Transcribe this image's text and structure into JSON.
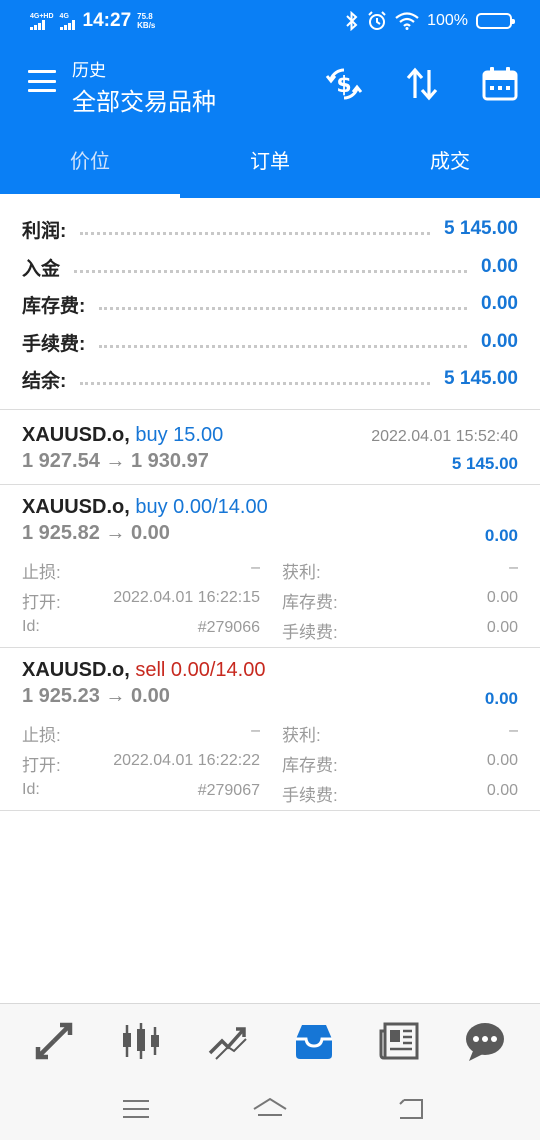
{
  "status_bar": {
    "network1": "4G+HD",
    "network2": "4G",
    "time": "14:27",
    "speed_value": "75.8",
    "speed_unit": "KB/s",
    "battery": "100%"
  },
  "header": {
    "subtitle": "历史",
    "title": "全部交易品种",
    "icons": [
      "menu-icon",
      "dollar-sync-icon",
      "sort-icon",
      "calendar-icon"
    ]
  },
  "tabs": [
    {
      "label": "价位",
      "active": true
    },
    {
      "label": "订单",
      "active": false
    },
    {
      "label": "成交",
      "active": false
    }
  ],
  "summary": [
    {
      "label": "利润:",
      "value": "5 145.00"
    },
    {
      "label": "入金",
      "value": "0.00"
    },
    {
      "label": "库存费:",
      "value": "0.00"
    },
    {
      "label": "手续费:",
      "value": "0.00"
    },
    {
      "label": "结余:",
      "value": "5 145.00"
    }
  ],
  "trades": [
    {
      "symbol": "XAUUSD.o,",
      "side": "buy 15.00",
      "side_type": "buy",
      "time": "2022.04.01 15:52:40",
      "prices": "1 927.54 → 1 930.97",
      "profit": "5 145.00"
    },
    {
      "symbol": "XAUUSD.o,",
      "side": "buy 0.00/14.00",
      "side_type": "buy",
      "prices": "1 925.82 → 0.00",
      "profit": "0.00",
      "details": {
        "sl_label": "止损:",
        "sl_value": "–",
        "tp_label": "获利:",
        "tp_value": "–",
        "open_label": "打开:",
        "open_value": "2022.04.01 16:22:15",
        "swap_label": "库存费:",
        "swap_value": "0.00",
        "id_label": "Id:",
        "id_value": "#279066",
        "fee_label": "手续费:",
        "fee_value": "0.00"
      }
    },
    {
      "symbol": "XAUUSD.o,",
      "side": "sell 0.00/14.00",
      "side_type": "sell",
      "prices": "1 925.23 → 0.00",
      "profit": "0.00",
      "details": {
        "sl_label": "止损:",
        "sl_value": "–",
        "tp_label": "获利:",
        "tp_value": "–",
        "open_label": "打开:",
        "open_value": "2022.04.01 16:22:22",
        "swap_label": "库存费:",
        "swap_value": "0.00",
        "id_label": "Id:",
        "id_value": "#279067",
        "fee_label": "手续费:",
        "fee_value": "0.00"
      }
    }
  ],
  "bottom_nav": [
    "quotes-icon",
    "chart-icon",
    "trade-icon",
    "history-icon",
    "news-icon",
    "chat-icon"
  ],
  "bottom_nav_active": "history-icon",
  "system_nav": [
    "recents-icon",
    "home-icon",
    "back-icon"
  ],
  "colors": {
    "primary": "#0a7ff5",
    "buy": "#1676d6",
    "sell": "#c7291f",
    "muted": "#9a9a9a"
  }
}
